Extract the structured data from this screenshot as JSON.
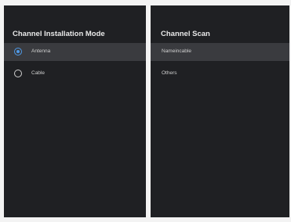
{
  "install_mode": {
    "title": "Channel Installation Mode",
    "options": [
      {
        "label": "Antenna",
        "selected": true
      },
      {
        "label": "Cable",
        "selected": false
      }
    ]
  },
  "channel_scan": {
    "title": "Channel Scan",
    "options": [
      {
        "label": "Nameincable"
      },
      {
        "label": "Others"
      }
    ]
  },
  "colors": {
    "panel_background": "#1f2023",
    "selected_row_background": "#3a3b3f",
    "accent": "#4f9ae8",
    "page_background": "#f3f3f3"
  }
}
